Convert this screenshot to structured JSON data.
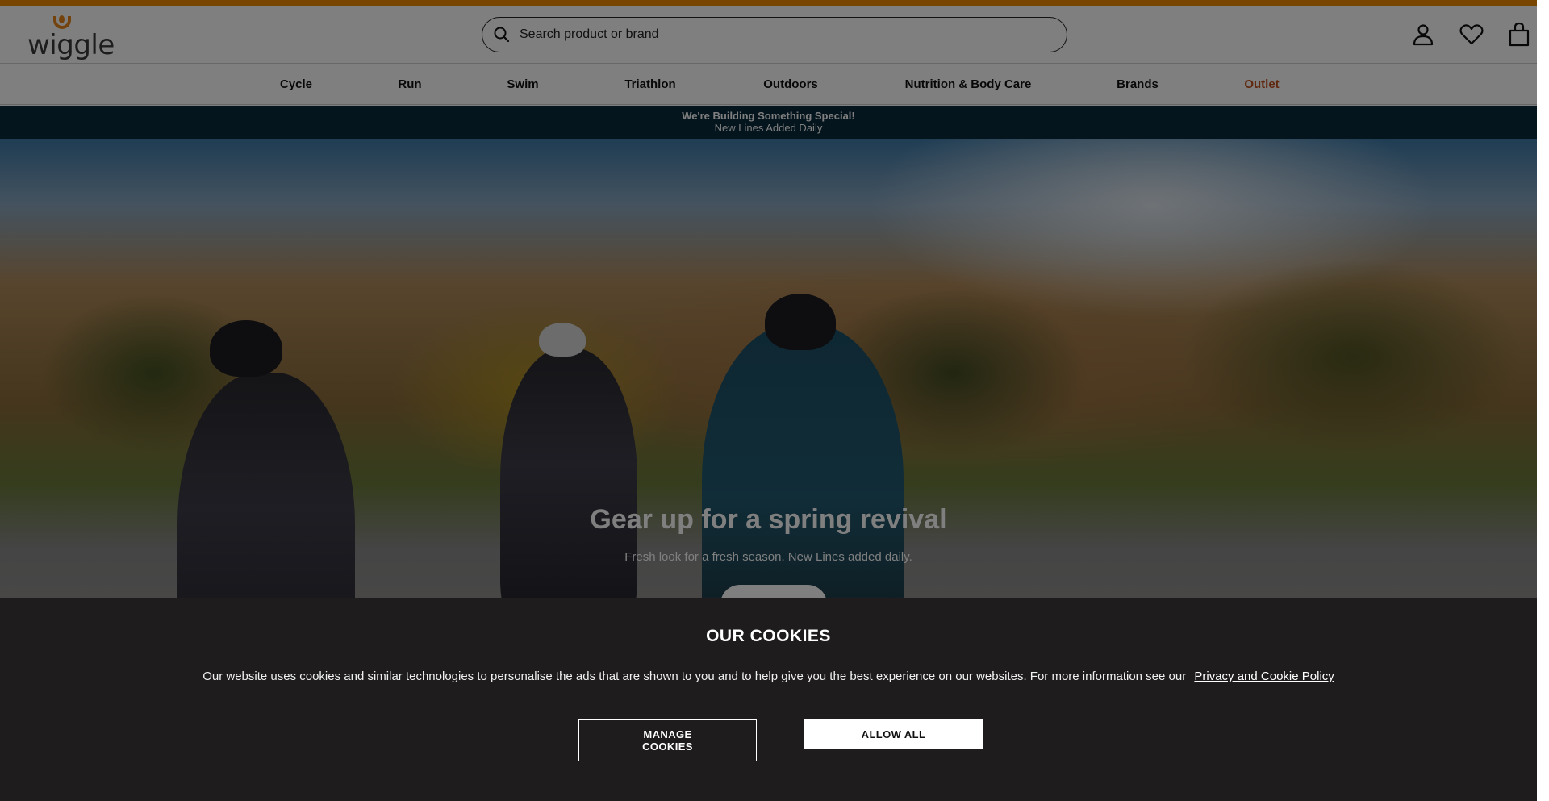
{
  "brand": {
    "name": "wiggle",
    "accent": "#f08c00",
    "outlet_color": "#c0501e",
    "promo_bg": "#0a2a3c"
  },
  "search": {
    "placeholder": "Search product or brand",
    "value": ""
  },
  "header_icons": [
    "account-icon",
    "wishlist-heart-icon",
    "basket-bag-icon"
  ],
  "nav": {
    "items": [
      {
        "label": "Cycle"
      },
      {
        "label": "Run"
      },
      {
        "label": "Swim"
      },
      {
        "label": "Triathlon"
      },
      {
        "label": "Outdoors"
      },
      {
        "label": "Nutrition & Body Care"
      },
      {
        "label": "Brands"
      },
      {
        "label": "Outlet"
      }
    ]
  },
  "promo": {
    "line1": "We're Building Something Special!",
    "line2": "New Lines Added Daily"
  },
  "hero": {
    "title": "Gear up for a spring revival",
    "subtitle": "Fresh look for a fresh season. New Lines added daily."
  },
  "cookie": {
    "title": "OUR COOKIES",
    "text": "Our website uses cookies and similar technologies to personalise the ads that are shown to you and to help give you the best experience on our websites. For more information see our",
    "link": "Privacy and Cookie Policy",
    "manage_label_1": "MANAGE",
    "manage_label_2": "COOKIES",
    "allow_label": "ALLOW ALL"
  }
}
